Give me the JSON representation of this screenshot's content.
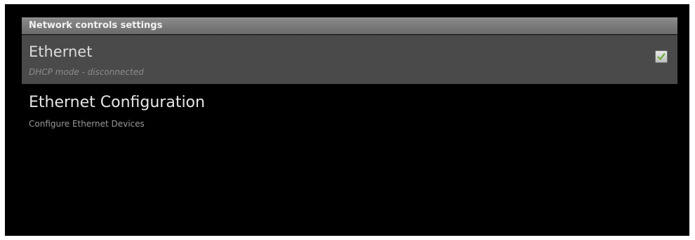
{
  "header": {
    "title": "Network controls settings"
  },
  "preferences": [
    {
      "title": "Ethernet",
      "summary": "DHCP mode - disconnected",
      "checked": true
    },
    {
      "title": "Ethernet Configuration",
      "summary": "Configure Ethernet Devices"
    }
  ],
  "icons": {
    "checkbox": "check-icon"
  }
}
